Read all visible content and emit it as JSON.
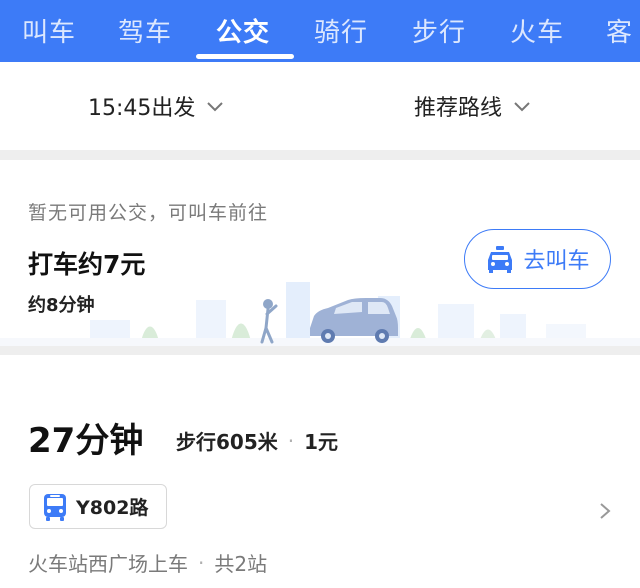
{
  "tabs": [
    {
      "label": "叫车",
      "active": false
    },
    {
      "label": "驾车",
      "active": false
    },
    {
      "label": "公交",
      "active": true
    },
    {
      "label": "骑行",
      "active": false
    },
    {
      "label": "步行",
      "active": false
    },
    {
      "label": "火车",
      "active": false
    },
    {
      "label": "客",
      "active": false
    }
  ],
  "filters": {
    "depart_time": "15:45出发",
    "route_pref": "推荐路线"
  },
  "taxi": {
    "note": "暂无可用公交，可叫车前往",
    "price": "打车约7元",
    "duration": "约8分钟",
    "button_label": "去叫车"
  },
  "route": {
    "duration": "27分钟",
    "walk": "步行605米",
    "separator": "·",
    "fare": "1元",
    "bus_line": "Y802路",
    "board_stop": "火车站西广场上车",
    "stops": "共2站"
  },
  "colors": {
    "brand_blue": "#3d7bf7",
    "muted_text": "#7a7a7a",
    "separator_gray": "#eeeeee"
  },
  "icons": {
    "filter_chevron": "chevron-down-icon",
    "taxi": "taxi-icon",
    "bus": "bus-icon",
    "route_arrow": "chevron-right-icon"
  }
}
